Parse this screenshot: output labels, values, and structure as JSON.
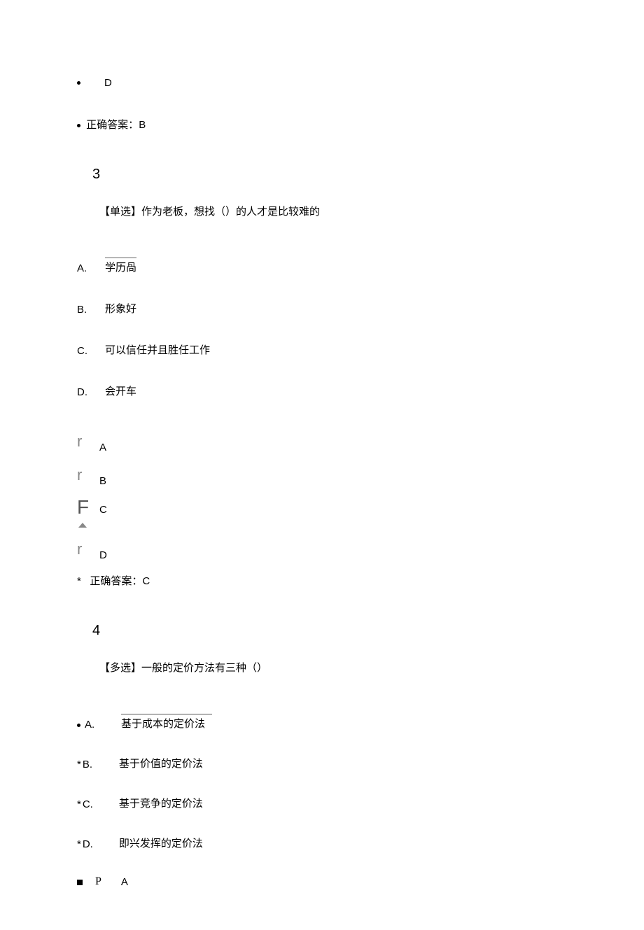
{
  "q2_remainder": {
    "last_option_letter": "D",
    "answer_prefix": "正确答案：",
    "answer_value": "B"
  },
  "q3": {
    "number": "3",
    "prompt": "【单选】作为老板，想找（）的人才是比较难的",
    "options": [
      {
        "letter": "A.",
        "text": "学历咼"
      },
      {
        "letter": "B.",
        "text": "形象好"
      },
      {
        "letter": "C.",
        "text": "可以信任并且胜任工作"
      },
      {
        "letter": "D.",
        "text": "会开车"
      }
    ],
    "radio_letters": [
      "A",
      "B",
      "C",
      "D"
    ],
    "answer_prefix": "正确答案：",
    "answer_star": "*",
    "answer_value": "C"
  },
  "q4": {
    "number": "4",
    "prompt": "【多选】一般的定价方法有三种（）",
    "options": [
      {
        "prefix_bullet": true,
        "letter": "A.",
        "text": "基于成本的定价法"
      },
      {
        "prefix_star": "*",
        "letter": "B.",
        "text": "基于价值的定价法"
      },
      {
        "prefix_star": "*",
        "letter": "C.",
        "text": "基于竞争的定价法"
      },
      {
        "prefix_star": "*",
        "letter": "D.",
        "text": "即兴发挥的定价法"
      }
    ],
    "check_marker": "P",
    "check_letter": "A"
  }
}
